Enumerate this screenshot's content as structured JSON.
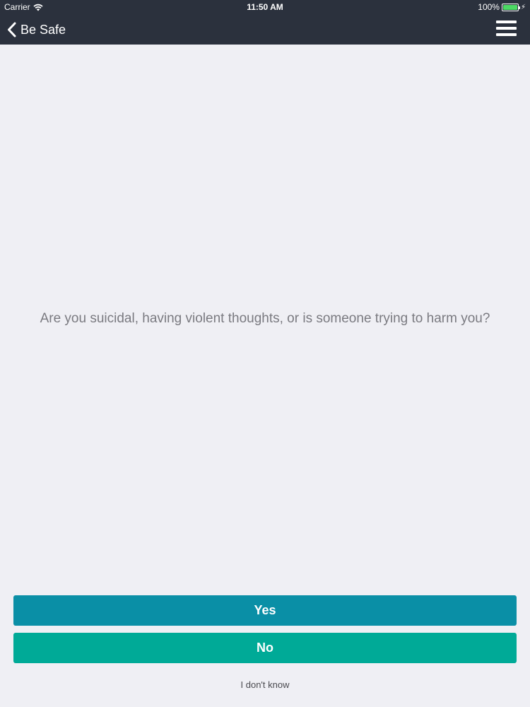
{
  "status_bar": {
    "carrier": "Carrier",
    "time": "11:50 AM",
    "battery": "100%",
    "wifi_icon": "wifi-icon",
    "battery_color": "#4cd964"
  },
  "nav": {
    "back_label": "Be Safe",
    "back_icon": "chevron-left-icon",
    "menu_icon": "hamburger-menu-icon"
  },
  "question": "Are you suicidal, having violent thoughts, or is someone trying to harm you?",
  "answers": {
    "yes_label": "Yes",
    "no_label": "No",
    "dont_know_label": "I don't know",
    "yes_color": "#0a8fa6",
    "no_color": "#00aa97"
  },
  "colors": {
    "header_bg": "#2b313d",
    "page_bg": "#efeff4"
  }
}
